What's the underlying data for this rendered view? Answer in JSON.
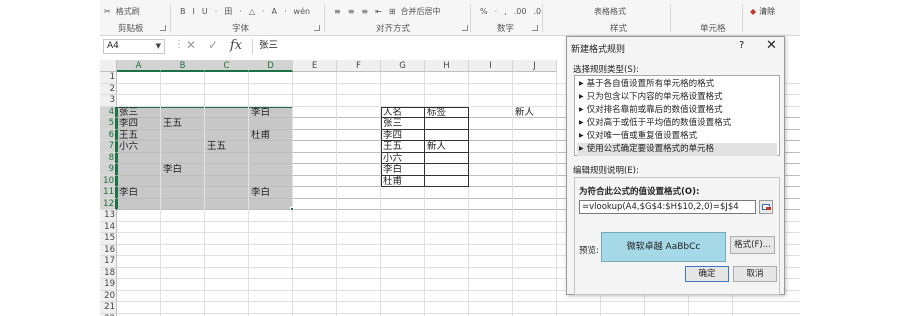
{
  "ribbon": {
    "clipboard_label": "剪贴板",
    "format_painter": "格式刷",
    "font_label": "字体",
    "font_buttons": [
      "B",
      "I",
      "U",
      "·",
      "田",
      "·",
      "△",
      "·",
      "A",
      "·",
      "wén"
    ],
    "align_label": "对齐方式",
    "merge_center": "合并后居中",
    "number_label": "数字",
    "number_buttons": [
      "%",
      "·",
      ",",
      ".00",
      ".0"
    ],
    "styles_label": "样式",
    "table_format": "表格格式",
    "cells_label": "单元格",
    "clear": "清除"
  },
  "formula_bar": {
    "name_box": "A4",
    "fx": "fx",
    "content": "张三"
  },
  "sheet": {
    "columns": [
      "A",
      "B",
      "C",
      "D",
      "E",
      "F",
      "G",
      "H",
      "I",
      "J"
    ],
    "rows": [
      "1",
      "2",
      "3",
      "4",
      "5",
      "6",
      "7",
      "8",
      "9",
      "10",
      "11",
      "12",
      "13",
      "14",
      "15",
      "16",
      "17",
      "18",
      "19",
      "20",
      "21",
      "22"
    ],
    "cells": [
      {
        "ref": "A4",
        "text": "张三"
      },
      {
        "ref": "D4",
        "text": "李白"
      },
      {
        "ref": "A5",
        "text": "李四"
      },
      {
        "ref": "B5",
        "text": "王五"
      },
      {
        "ref": "A6",
        "text": "王五"
      },
      {
        "ref": "D6",
        "text": "杜甫"
      },
      {
        "ref": "A7",
        "text": "小六"
      },
      {
        "ref": "C7",
        "text": "王五"
      },
      {
        "ref": "B9",
        "text": "李白"
      },
      {
        "ref": "A11",
        "text": "李白"
      },
      {
        "ref": "D11",
        "text": "李白"
      },
      {
        "ref": "G4",
        "text": "人名"
      },
      {
        "ref": "H4",
        "text": "标签"
      },
      {
        "ref": "J4",
        "text": "新人"
      },
      {
        "ref": "G5",
        "text": "张三"
      },
      {
        "ref": "G6",
        "text": "李四"
      },
      {
        "ref": "G7",
        "text": "王五"
      },
      {
        "ref": "H7",
        "text": "新人"
      },
      {
        "ref": "G8",
        "text": "小六"
      },
      {
        "ref": "G9",
        "text": "李白"
      },
      {
        "ref": "G10",
        "text": "杜甫"
      }
    ]
  },
  "dialog": {
    "title": "新建格式规则",
    "help": "?",
    "close": "✕",
    "select_type_label": "选择规则类型(S):",
    "rule_types": [
      "基于各自值设置所有单元格的格式",
      "只为包含以下内容的单元格设置格式",
      "仅对排名靠前或靠后的数值设置格式",
      "仅对高于或低于平均值的数值设置格式",
      "仅对唯一值或重复值设置格式",
      "使用公式确定要设置格式的单元格"
    ],
    "selected_rule_index": 5,
    "edit_desc_label": "编辑规则说明(E):",
    "formula_label": "为符合此公式的值设置格式(O):",
    "formula": "=vlookup(A4,$G$4:$H$10,2,0)=$J$4",
    "preview_label": "预览:",
    "preview_text": "微软卓越  AaBbCc",
    "preview_color": "#a6d9e8",
    "format_button": "格式(F)...",
    "ok_button": "确定",
    "cancel_button": "取消"
  }
}
